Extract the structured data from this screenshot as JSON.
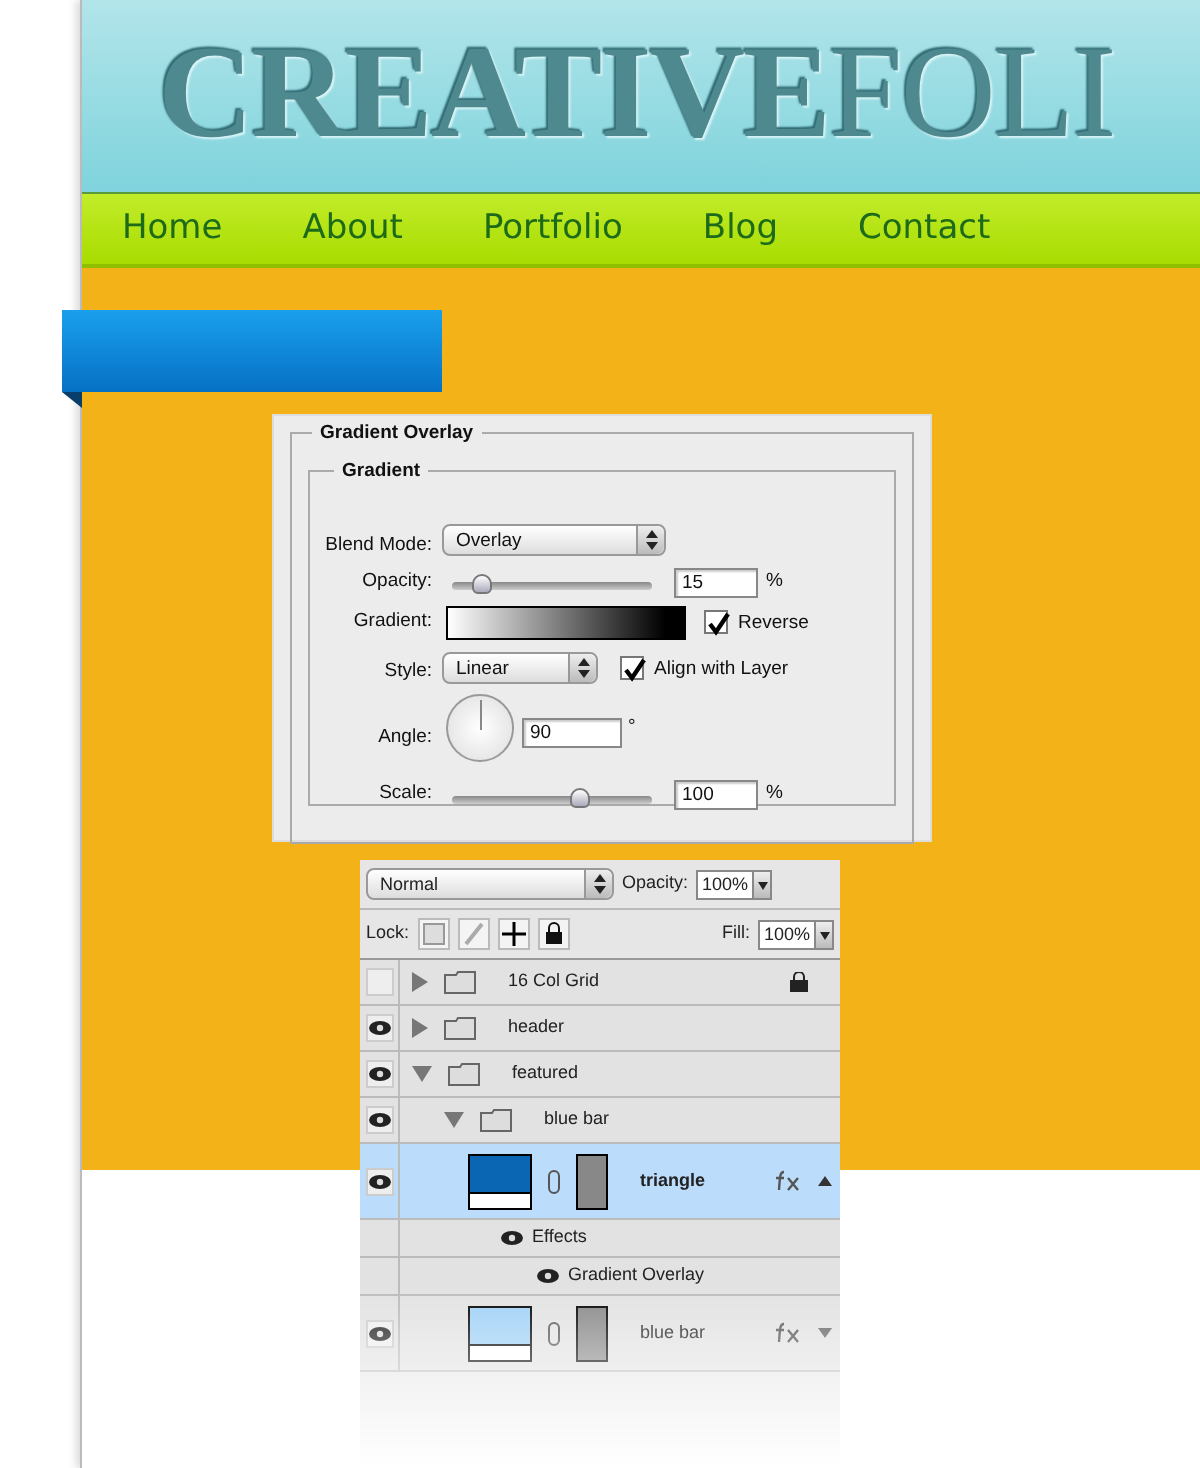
{
  "header": {
    "logo_bold": "CREATIVE",
    "logo_light": "FOLI"
  },
  "nav": [
    {
      "label": "Home"
    },
    {
      "label": "About"
    },
    {
      "label": "Portfolio"
    },
    {
      "label": "Blog"
    },
    {
      "label": "Contact"
    }
  ],
  "layer_style": {
    "title": "Gradient Overlay",
    "group": "Gradient",
    "blend_mode_label": "Blend Mode:",
    "blend_mode": "Overlay",
    "opacity_label": "Opacity:",
    "opacity_slider": {
      "level": 0.15
    },
    "opacity_value": "15",
    "opacity_unit": "%",
    "gradient_label": "Gradient:",
    "reverse": {
      "label": "Reverse",
      "checked": true
    },
    "style_label": "Style:",
    "style": "Linear",
    "align": {
      "label": "Align with Layer",
      "checked": true
    },
    "angle_label": "Angle:",
    "angle_value": "90",
    "angle_unit": "°",
    "scale_label": "Scale:",
    "scale_slider": {
      "level": 0.64
    },
    "scale_value": "100",
    "scale_unit": "%"
  },
  "layers_panel": {
    "blend_mode": "Normal",
    "opacity_label": "Opacity:",
    "opacity": "100%",
    "lock_label": "Lock:",
    "fill_label": "Fill:",
    "fill": "100%",
    "layers": [
      {
        "kind": "group",
        "name": "16 Col Grid",
        "visible": false,
        "expanded": false,
        "locked": true,
        "selected": false
      },
      {
        "kind": "group",
        "name": "header",
        "visible": true,
        "expanded": false,
        "locked": false,
        "selected": false
      },
      {
        "kind": "group",
        "name": "featured",
        "visible": true,
        "expanded": true,
        "locked": false,
        "selected": false,
        "children": [
          {
            "kind": "group",
            "name": "blue bar",
            "visible": true,
            "expanded": true,
            "locked": false,
            "selected": false,
            "children": [
              {
                "kind": "layer",
                "name": "triangle",
                "visible": true,
                "selected": true,
                "color": "#0a66b2",
                "effects": [
                  {
                    "name": "Effects"
                  },
                  {
                    "name": "Gradient Overlay"
                  }
                ]
              },
              {
                "kind": "layer",
                "name": "blue bar",
                "visible": true,
                "selected": false,
                "color": "#9fd0f6"
              }
            ]
          }
        ]
      }
    ]
  }
}
